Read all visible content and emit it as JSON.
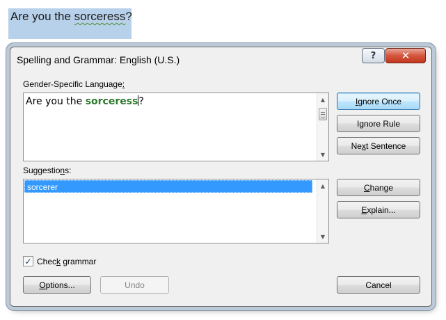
{
  "document": {
    "text_before": "Are you the ",
    "text_error": "sorceress",
    "text_after": "?"
  },
  "dialog": {
    "title": "Spelling and Grammar: English (U.S.)",
    "help_glyph": "?",
    "close_glyph": "✕"
  },
  "sentence_panel": {
    "label_pre": "Gender-Specific Language",
    "label_accel": ":",
    "label_post": "",
    "text_before": "Are you the ",
    "text_error": "sorceress",
    "text_after": "?"
  },
  "suggestions_panel": {
    "label_pre": "Suggestio",
    "label_accel": "n",
    "label_post": "s:",
    "items": [
      "sorcerer"
    ]
  },
  "check_grammar": {
    "checked": true,
    "check_glyph": "✓",
    "label_pre": "Chec",
    "label_accel": "k",
    "label_post": " grammar"
  },
  "buttons": {
    "ignore_once": {
      "pre": "",
      "accel": "I",
      "post": "gnore Once"
    },
    "ignore_rule": {
      "pre": "I",
      "accel": "g",
      "post": "nore Rule"
    },
    "next_sentence": {
      "pre": "Ne",
      "accel": "x",
      "post": "t Sentence"
    },
    "change": {
      "pre": "",
      "accel": "C",
      "post": "hange"
    },
    "explain": {
      "pre": "",
      "accel": "E",
      "post": "xplain..."
    },
    "options": {
      "pre": "",
      "accel": "O",
      "post": "ptions..."
    },
    "undo": {
      "pre": "",
      "accel": "",
      "post": "Undo"
    },
    "cancel": {
      "pre": "",
      "accel": "",
      "post": "Cancel"
    }
  },
  "scroll_glyphs": {
    "up": "▲",
    "down": "▼"
  },
  "icons": {
    "scroll_up": "scroll-up-arrow-icon",
    "scroll_down": "scroll-down-arrow-icon",
    "help": "help-icon",
    "close": "close-icon",
    "checkmark": "checkmark-icon"
  },
  "colors": {
    "selection_highlight": "#b8d1ea",
    "error_text": "#2c7a2c",
    "suggestion_selected": "#3399ff",
    "close_button": "#c2381f",
    "default_button_border": "#3c7fb1"
  }
}
